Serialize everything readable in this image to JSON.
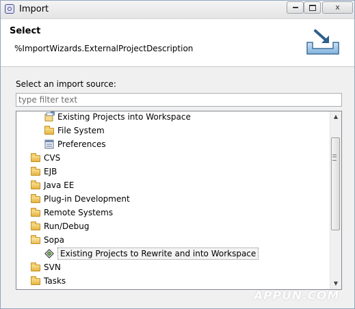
{
  "window": {
    "title": "Import",
    "controls": {
      "minimize_icon": "minimize-icon",
      "maximize_icon": "maximize-icon",
      "close_label": "x"
    }
  },
  "header": {
    "title": "Select",
    "description": "%ImportWizards.ExternalProjectDescription",
    "icon": "import-wizard-icon"
  },
  "source": {
    "label": "Select an import source:",
    "filter_placeholder": "type filter text",
    "filter_value": ""
  },
  "tree": {
    "items": [
      {
        "label": "Existing Projects into Workspace",
        "icon": "project-import-icon",
        "depth": 1,
        "selected": false
      },
      {
        "label": "File System",
        "icon": "folder-icon",
        "depth": 1,
        "selected": false
      },
      {
        "label": "Preferences",
        "icon": "preferences-icon",
        "depth": 1,
        "selected": false
      },
      {
        "label": "CVS",
        "icon": "folder-icon",
        "depth": 0,
        "selected": false
      },
      {
        "label": "EJB",
        "icon": "folder-icon",
        "depth": 0,
        "selected": false
      },
      {
        "label": "Java EE",
        "icon": "folder-icon",
        "depth": 0,
        "selected": false
      },
      {
        "label": "Plug-in Development",
        "icon": "folder-icon",
        "depth": 0,
        "selected": false
      },
      {
        "label": "Remote Systems",
        "icon": "folder-icon",
        "depth": 0,
        "selected": false
      },
      {
        "label": "Run/Debug",
        "icon": "folder-icon",
        "depth": 0,
        "selected": false
      },
      {
        "label": "Sopa",
        "icon": "folder-open-icon",
        "depth": 0,
        "selected": false
      },
      {
        "label": "Existing Projects to Rewrite and into Workspace",
        "icon": "sopa-project-icon",
        "depth": 1,
        "selected": true
      },
      {
        "label": "SVN",
        "icon": "folder-icon",
        "depth": 0,
        "selected": false
      },
      {
        "label": "Tasks",
        "icon": "folder-icon",
        "depth": 0,
        "selected": false
      }
    ]
  },
  "scrollbar": {
    "up_icon": "scroll-up-icon",
    "down_icon": "scroll-down-icon",
    "position_fraction": 0.2
  },
  "watermark": "APPUN.COM"
}
